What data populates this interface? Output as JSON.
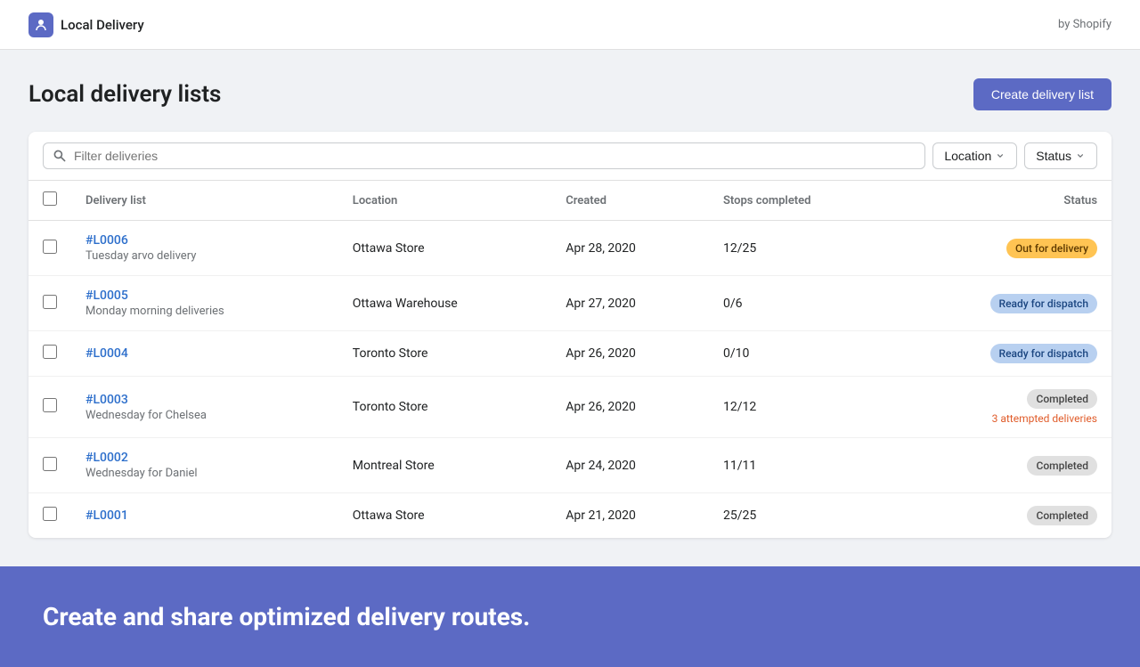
{
  "header": {
    "brand_name": "Local Delivery",
    "shopify_label": "by Shopify"
  },
  "page": {
    "title": "Local delivery lists",
    "create_button": "Create delivery list"
  },
  "filters": {
    "search_placeholder": "Filter deliveries",
    "location_label": "Location",
    "status_label": "Status"
  },
  "table": {
    "columns": [
      "Delivery list",
      "Location",
      "Created",
      "Stops completed",
      "Status"
    ],
    "rows": [
      {
        "id": "#L0006",
        "sub": "Tuesday arvo delivery",
        "location": "Ottawa Store",
        "created": "Apr 28, 2020",
        "stops": "12/25",
        "status": "Out for delivery",
        "status_type": "yellow"
      },
      {
        "id": "#L0005",
        "sub": "Monday morning deliveries",
        "location": "Ottawa Warehouse",
        "created": "Apr 27, 2020",
        "stops": "0/6",
        "status": "Ready for dispatch",
        "status_type": "blue"
      },
      {
        "id": "#L0004",
        "sub": "",
        "location": "Toronto Store",
        "created": "Apr 26, 2020",
        "stops": "0/10",
        "status": "Ready for dispatch",
        "status_type": "blue"
      },
      {
        "id": "#L0003",
        "sub": "Wednesday for Chelsea",
        "location": "Toronto Store",
        "created": "Apr 26, 2020",
        "stops": "12/12",
        "status": "Completed",
        "status_type": "gray",
        "attempted": "3 attempted deliveries"
      },
      {
        "id": "#L0002",
        "sub": "Wednesday for Daniel",
        "location": "Montreal Store",
        "created": "Apr 24, 2020",
        "stops": "11/11",
        "status": "Completed",
        "status_type": "gray"
      },
      {
        "id": "#L0001",
        "sub": "",
        "location": "Ottawa Store",
        "created": "Apr 21, 2020",
        "stops": "25/25",
        "status": "Completed",
        "status_type": "gray"
      }
    ]
  },
  "footer": {
    "banner_text": "Create and share optimized delivery routes."
  }
}
